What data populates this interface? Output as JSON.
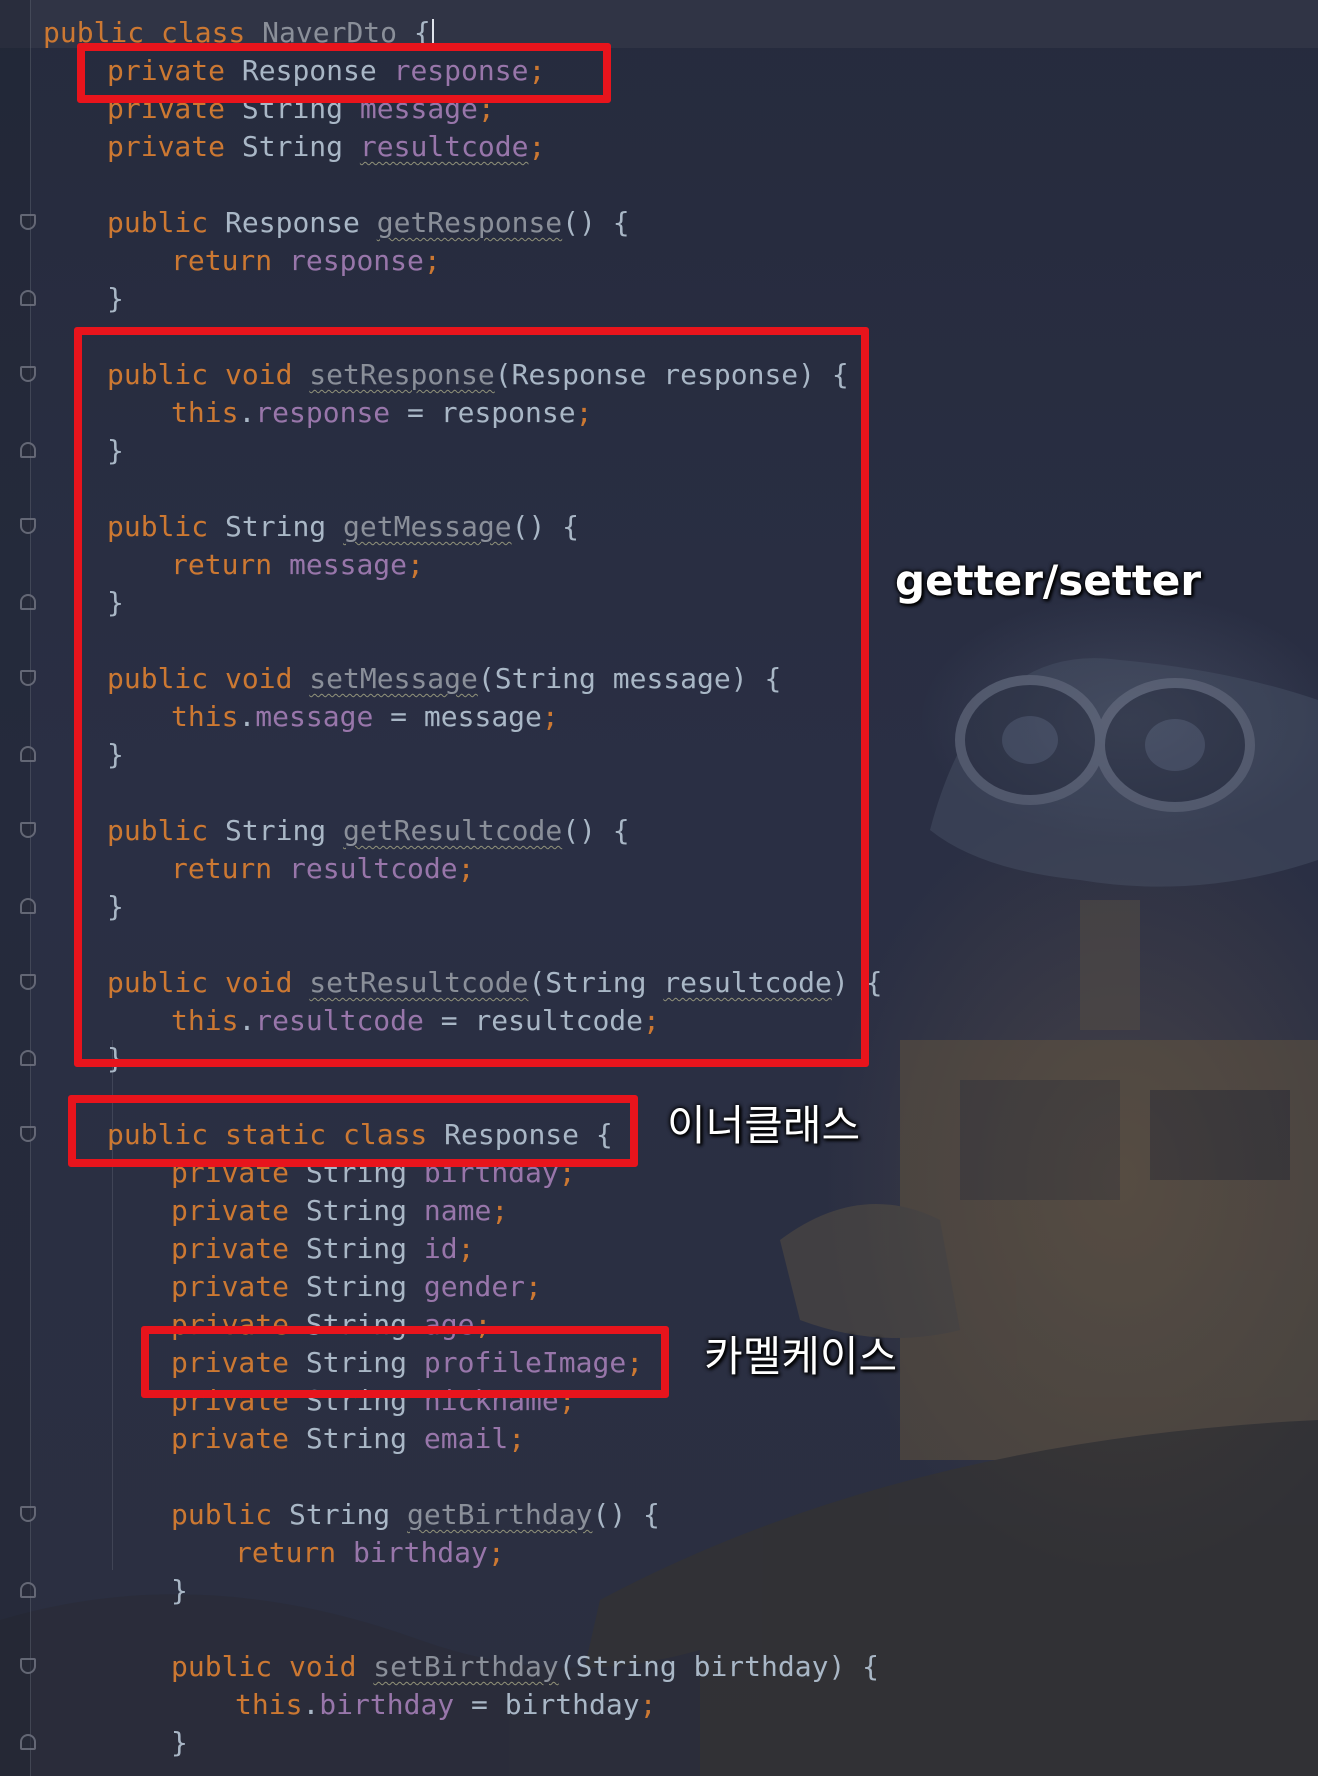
{
  "code": {
    "class_decl": {
      "kw": "public class",
      "name": "NaverDto",
      "brace": "{"
    },
    "fields": [
      {
        "mod": "private",
        "type": "Response",
        "name": "response",
        "end": ";"
      },
      {
        "mod": "private",
        "type": "String",
        "name": "message",
        "end": ";"
      },
      {
        "mod": "private",
        "type": "String",
        "name": "resultcode",
        "end": ";"
      }
    ],
    "get_response": {
      "sig": "public",
      "type": "Response",
      "name": "getResponse",
      "rest": "() {",
      "ret": "return",
      "val": "response",
      "end": ";",
      "close": "}"
    },
    "set_response": {
      "sig": "public void",
      "name": "setResponse",
      "params": "(Response response) {",
      "this": "this",
      "field": "response",
      "assign": " = response",
      "end": ";",
      "close": "}"
    },
    "get_message": {
      "sig": "public",
      "type": "String",
      "name": "getMessage",
      "rest": "() {",
      "ret": "return",
      "val": "message",
      "end": ";",
      "close": "}"
    },
    "set_message": {
      "sig": "public void",
      "name": "setMessage",
      "params": "(String message) {",
      "this": "this",
      "field": "message",
      "assign": " = message",
      "end": ";",
      "close": "}"
    },
    "get_resultcode": {
      "sig": "public",
      "type": "String",
      "name": "getResultcode",
      "rest": "() {",
      "ret": "return",
      "val": "resultcode",
      "end": ";",
      "close": "}"
    },
    "set_resultcode": {
      "sig": "public void",
      "name": "setResultcode",
      "params_a": "(String ",
      "param": "resultcode",
      "params_b": ") {",
      "this": "this",
      "field": "resultcode",
      "assign": " = resultcode",
      "end": ";",
      "close": "}"
    },
    "inner_class": {
      "kw": "public static class",
      "name": "Response",
      "brace": " {"
    },
    "inner_fields": [
      {
        "mod": "private",
        "type": "String",
        "name": "birthday",
        "end": ";"
      },
      {
        "mod": "private",
        "type": "String",
        "name": "name",
        "end": ";"
      },
      {
        "mod": "private",
        "type": "String",
        "name": "id",
        "end": ";"
      },
      {
        "mod": "private",
        "type": "String",
        "name": "gender",
        "end": ";"
      },
      {
        "mod": "private",
        "type": "String",
        "name": "age",
        "end": ";"
      },
      {
        "mod": "private",
        "type": "String",
        "name": "profileImage",
        "end": ";"
      },
      {
        "mod": "private",
        "type": "String",
        "name": "nickname",
        "end": ";"
      },
      {
        "mod": "private",
        "type": "String",
        "name": "email",
        "end": ";"
      }
    ],
    "get_birthday": {
      "sig": "public",
      "type": "String",
      "name": "getBirthday",
      "rest": "() {",
      "ret": "return",
      "val": "birthday",
      "end": ";",
      "close": "}"
    },
    "set_birthday": {
      "sig": "public void",
      "name": "setBirthday",
      "params": "(String birthday) {",
      "this": "this",
      "field": "birthday",
      "assign": " = birthday",
      "end": ";",
      "close": "}"
    }
  },
  "annotations": {
    "getter_setter": "getter/setter",
    "inner_class": "이너클래스",
    "camel_case": "카멜케이스"
  },
  "colors": {
    "keyword": "#cc7832",
    "field": "#9876aa",
    "plain": "#a9b7c6",
    "highlight_box": "#e8141c",
    "annotation_text": "#ffffff"
  }
}
